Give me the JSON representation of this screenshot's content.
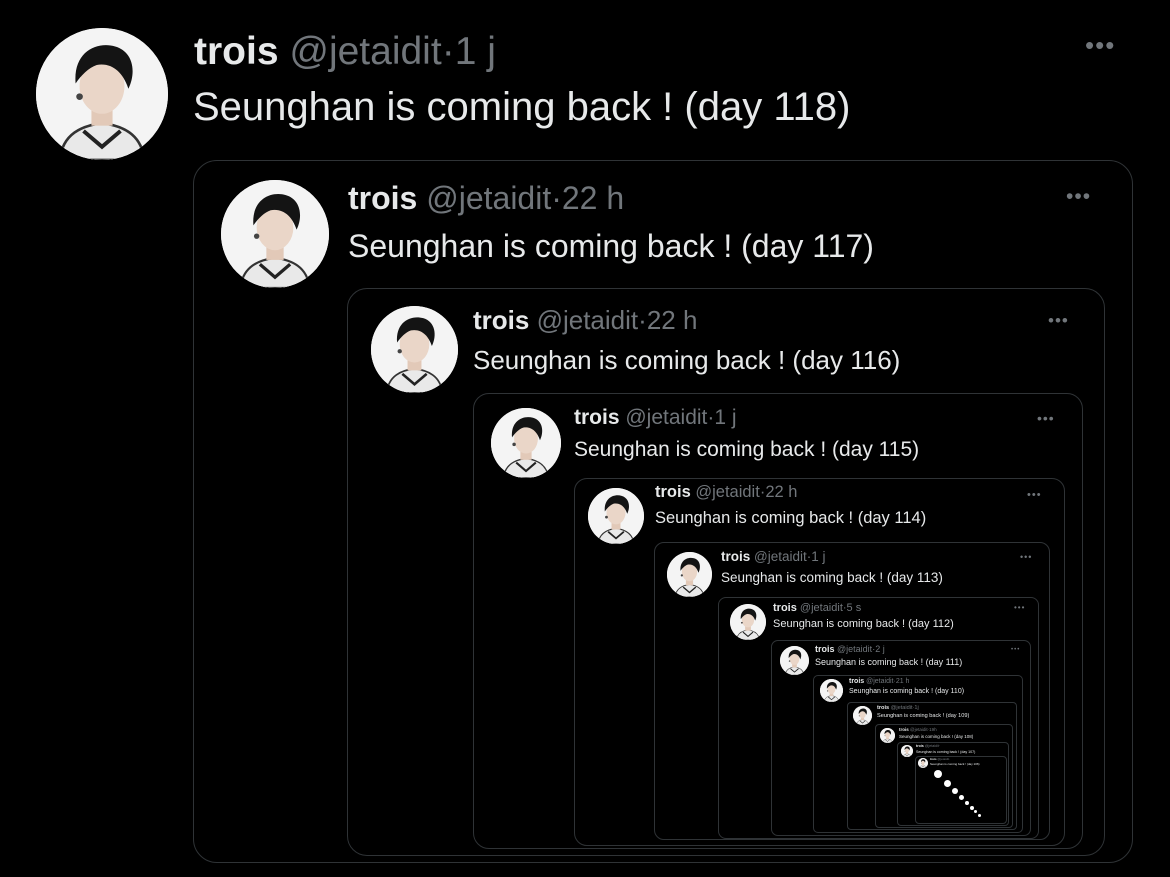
{
  "tweets": [
    {
      "name": "trois",
      "handle": "@jetaidit",
      "dot": "·",
      "time": "1 j",
      "text": "Seunghan is coming back ! (day 118)",
      "more": "•••"
    },
    {
      "name": "trois",
      "handle": "@jetaidit",
      "dot": "·",
      "time": "22 h",
      "text": "Seunghan is coming back ! (day 117)",
      "more": "•••"
    },
    {
      "name": "trois",
      "handle": "@jetaidit",
      "dot": "·",
      "time": "22 h",
      "text": "Seunghan is coming back ! (day 116)",
      "more": "•••"
    },
    {
      "name": "trois",
      "handle": "@jetaidit",
      "dot": "·",
      "time": "1 j",
      "text": "Seunghan is coming back ! (day 115)",
      "more": "•••"
    },
    {
      "name": "trois",
      "handle": "@jetaidit",
      "dot": "·",
      "time": "22 h",
      "text": "Seunghan is coming back ! (day 114)",
      "more": "•••"
    },
    {
      "name": "trois",
      "handle": "@jetaidit",
      "dot": "·",
      "time": "1 j",
      "text": "Seunghan is coming back ! (day 113)",
      "more": "•••"
    },
    {
      "name": "trois",
      "handle": "@jetaidit",
      "dot": "·",
      "time": "5 s",
      "text": "Seunghan is coming back ! (day 112)",
      "more": "•••"
    },
    {
      "name": "trois",
      "handle": "@jetaidit",
      "dot": "·",
      "time": "2 j",
      "text": "Seunghan is coming back ! (day 111)",
      "more": "•••"
    },
    {
      "name": "trois",
      "handle": "@jetaidit",
      "dot": "·",
      "time": "21 h",
      "text": "Seunghan is coming back ! (day 110)",
      "more": ""
    },
    {
      "name": "trois",
      "handle": "@jetaidit",
      "dot": "·",
      "time": "1j",
      "text": "Seunghan is coming back ! (day 109)",
      "more": ""
    },
    {
      "name": "trois",
      "handle": "@jetaidit",
      "dot": "·",
      "time": "19h",
      "text": "Seunghan is coming back ! (day 108)",
      "more": ""
    },
    {
      "name": "trois",
      "handle": "@jetaidit",
      "dot": "·",
      "time": "",
      "text": "Seunghan is coming back ! (day 107)",
      "more": ""
    },
    {
      "name": "trois",
      "handle": "@jetaidit",
      "dot": "·",
      "time": "",
      "text": "Seunghan is coming back ! (day 106)",
      "more": ""
    }
  ]
}
